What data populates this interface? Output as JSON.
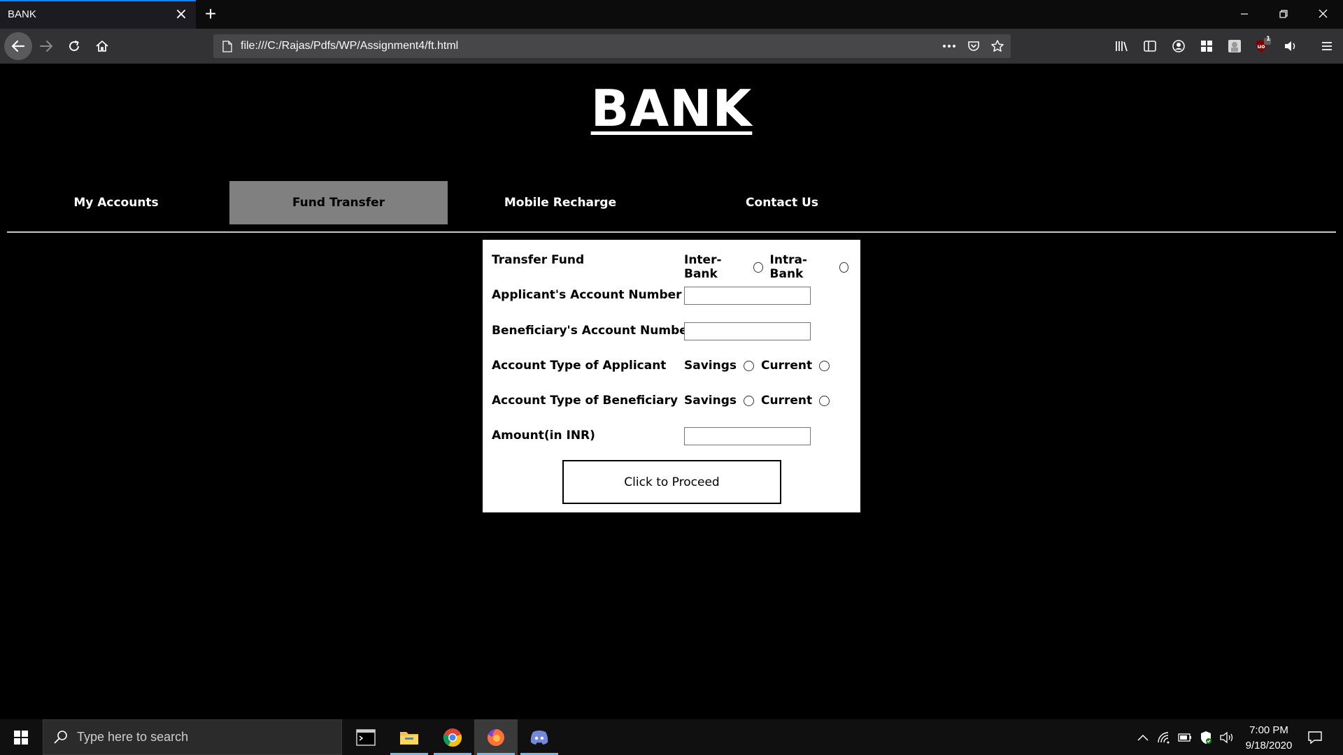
{
  "browser": {
    "tab_title": "BANK",
    "url": "file:///C:/Rajas/Pdfs/WP/Assignment4/ft.html",
    "addon_badge": "1"
  },
  "page": {
    "bank_title": "BANK",
    "nav": [
      {
        "label": "My Accounts",
        "active": false
      },
      {
        "label": "Fund Transfer",
        "active": true
      },
      {
        "label": "Mobile Recharge",
        "active": false
      },
      {
        "label": "Contact Us",
        "active": false
      }
    ],
    "form": {
      "transfer_fund_label": "Transfer Fund",
      "inter_bank_label": "Inter-Bank",
      "intra_bank_label": "Intra-Bank",
      "applicant_account_label": "Applicant's Account Number",
      "applicant_account_value": "",
      "beneficiary_account_label": "Beneficiary's Account Number",
      "beneficiary_account_value": "",
      "applicant_type_label": "Account Type of Applicant",
      "beneficiary_type_label": "Account Type of Beneficiary",
      "savings_label": "Savings",
      "current_label": "Current",
      "amount_label": "Amount(in INR)",
      "amount_value": "",
      "proceed_label": "Click to Proceed"
    }
  },
  "taskbar": {
    "search_placeholder": "Type here to search",
    "time": "7:00 PM",
    "date": "9/18/2020"
  },
  "colors": {
    "active_tab_bg": "#808080",
    "browser_accent": "#0a84ff",
    "page_bg": "#000000"
  }
}
